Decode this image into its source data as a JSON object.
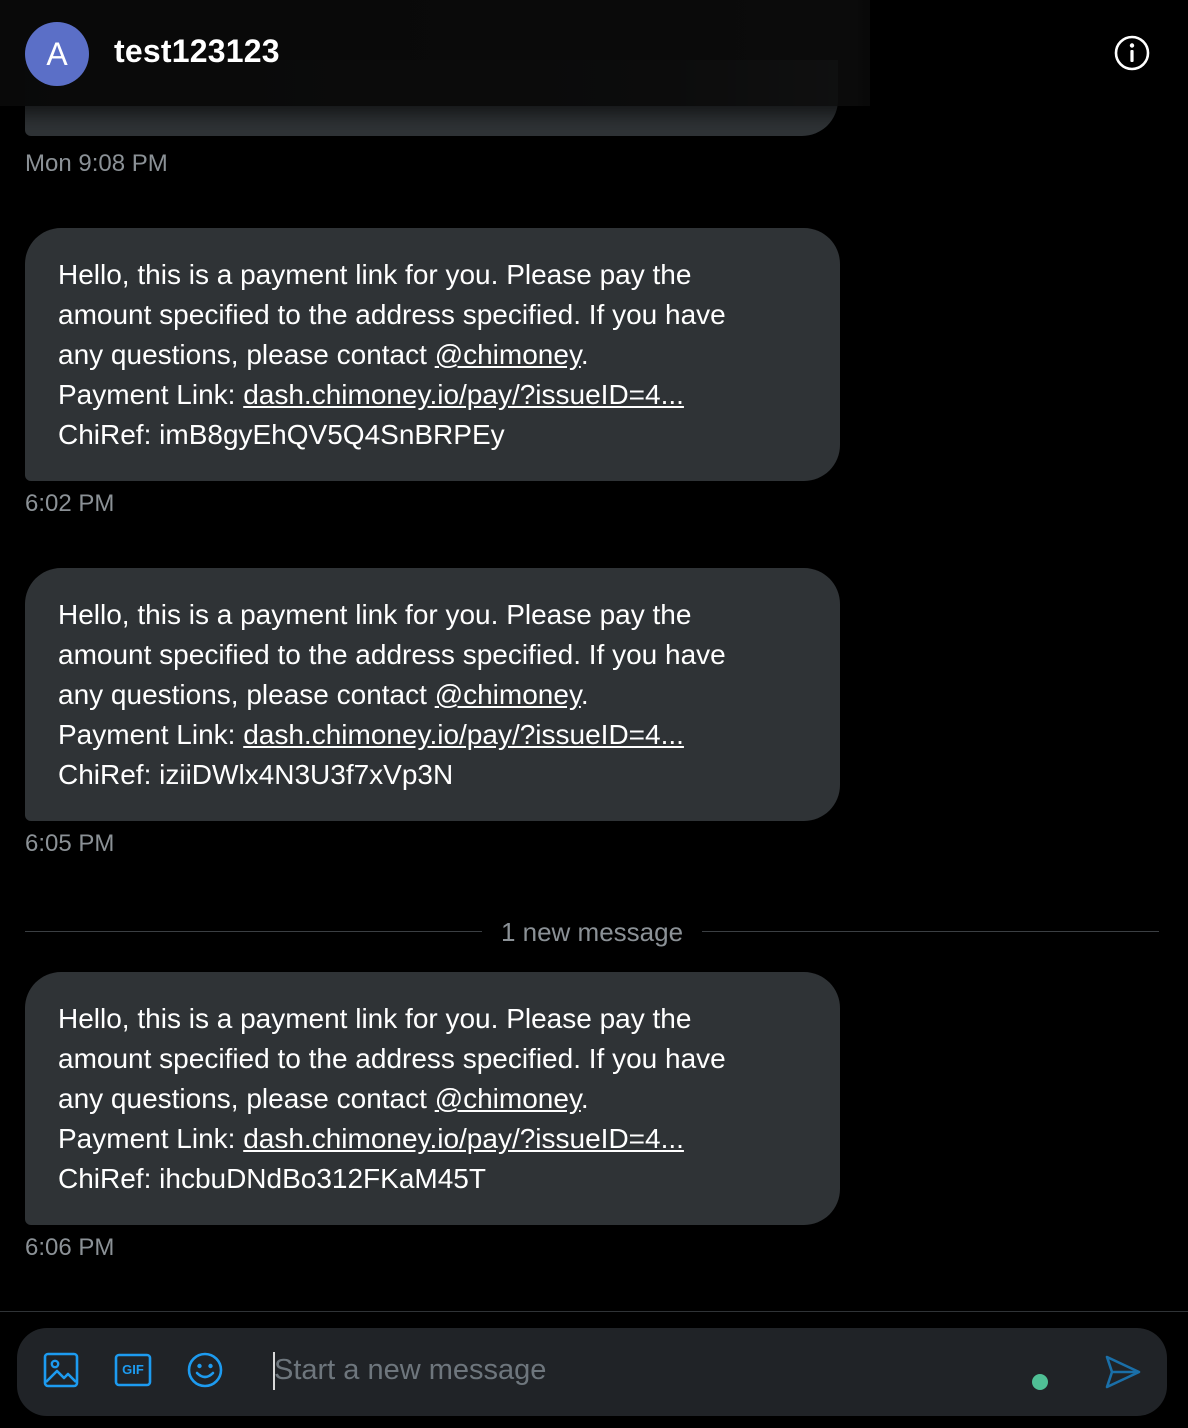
{
  "header": {
    "avatar_letter": "A",
    "title": "test123123",
    "info_icon": "info-icon"
  },
  "earlier_timestamp": "Mon 9:08 PM",
  "messages": [
    {
      "lines": [
        "Hello, this is a payment link for you. Please pay the",
        "amount specified to the address specified. If you have"
      ],
      "contact_prefix": "any questions, please contact ",
      "mention": "@chimoney",
      "contact_suffix": ".",
      "link_label": "Payment Link: ",
      "link_text": "dash.chimoney.io/pay/?issueID=4...",
      "chiref": "ChiRef: imB8gyEhQV5Q4SnBRPEy",
      "timestamp": "6:02 PM"
    },
    {
      "lines": [
        "Hello, this is a payment link for you. Please pay the",
        "amount specified to the address specified. If you have"
      ],
      "contact_prefix": "any questions, please contact ",
      "mention": "@chimoney",
      "contact_suffix": ".",
      "link_label": "Payment Link: ",
      "link_text": "dash.chimoney.io/pay/?issueID=4...",
      "chiref": "ChiRef: iziiDWlx4N3U3f7xVp3N",
      "timestamp": "6:05 PM"
    },
    {
      "lines": [
        "Hello, this is a payment link for you. Please pay the",
        "amount specified to the address specified. If you have"
      ],
      "contact_prefix": "any questions, please contact ",
      "mention": "@chimoney",
      "contact_suffix": ".",
      "link_label": "Payment Link: ",
      "link_text": "dash.chimoney.io/pay/?issueID=4...",
      "chiref": "ChiRef: ihcbuDNdBo312FKaM45T",
      "timestamp": "6:06 PM"
    }
  ],
  "divider": {
    "label": "1 new message"
  },
  "composer": {
    "placeholder": "Start a new message",
    "icons": [
      "image-icon",
      "gif-icon",
      "emoji-icon",
      "send-icon"
    ],
    "gif_label": "GIF"
  },
  "colors": {
    "background": "#000000",
    "bubble": "#2f3336",
    "accent": "#1d9bf0",
    "avatar": "#5b6fc7",
    "status_dot": "#4fbf95"
  }
}
